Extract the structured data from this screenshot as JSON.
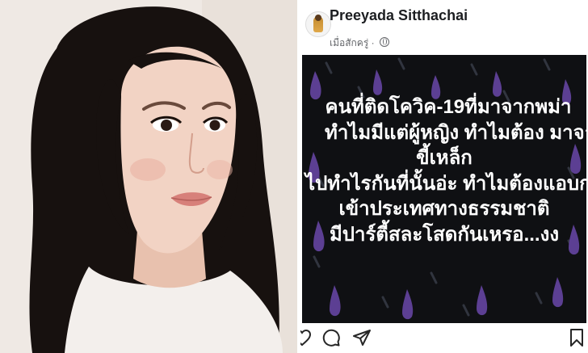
{
  "post": {
    "author": "Preeyada Sitthachai",
    "timestamp": "เมื่อสักครู่",
    "separator": "·",
    "privacy_icon": "globe-icon",
    "image_text": {
      "line1": "คนที่ติดโควิค-19ที่มาจากพม่า",
      "line2": "ทำไมมีแต่ผู้หญิง ทำไมต้อง มาจากท่า",
      "line3": "ขี้เหล็ก",
      "line4": "ไปทำไรกันที่นั้นอ่ะ ทำไมต้องแอบกลับ",
      "line5": "เข้าประเทศทางธรรมชาติ",
      "line6": "มีปาร์ตี้สละโสดกันเหรอ...งง"
    }
  },
  "actions": [
    "heart-icon",
    "comment-icon",
    "share-icon",
    "bookmark-icon"
  ],
  "colors": {
    "image_background": "#0f1013",
    "drop_color": "#5c3f93",
    "streak_color": "#3a3f4a",
    "text_color": "#ffffff"
  }
}
